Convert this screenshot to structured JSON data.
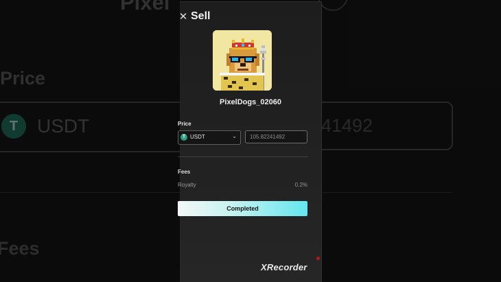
{
  "background": {
    "title_partial": "Pixel",
    "price_label": "Price",
    "token": "USDT",
    "token_icon": "tether-icon",
    "price_partial": "41492",
    "fees_label": "Fees"
  },
  "dialog": {
    "title": "Sell",
    "close_icon": "close-icon",
    "nft_name": "PixelDogs_02060",
    "price_label": "Price",
    "token": {
      "selected": "USDT",
      "icon_glyph": "T",
      "icon_color": "#2aa083"
    },
    "price_value": "105.82241492",
    "fees_label": "Fees",
    "royalty_label": "Royalty",
    "royalty_value": "0.2%",
    "submit_label": "Completed"
  },
  "watermark": "XRecorder",
  "colors": {
    "accent_gradient_start": "#f3f8f8",
    "accent_gradient_end": "#64e6ef",
    "panel_bg": "#1d1d1d",
    "nft_bg": "#f1e6a2"
  }
}
